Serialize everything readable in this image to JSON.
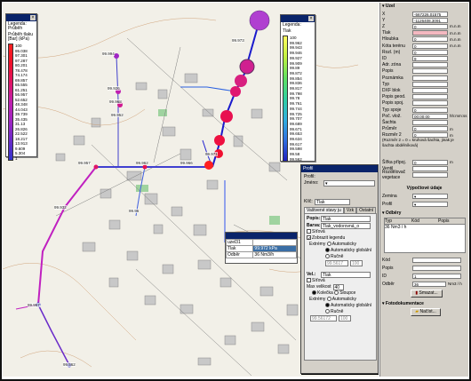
{
  "legend_left": {
    "title": "Legenda: Průběh",
    "subtitle": "Průběh tlaku [Bar] (kPa)",
    "ticks": [
      "100",
      "95.038",
      "97.301",
      "97.287",
      "80.201",
      "78.478",
      "74.174",
      "69.857",
      "65.555",
      "61.251",
      "56.957",
      "52.652",
      "48.348",
      "44.043",
      "39.739",
      "35.435",
      "31.13",
      "26.826",
      "22.522",
      "18.217",
      "13.913",
      "9.609",
      "5.304",
      "1"
    ],
    "colors": [
      "#3333cc",
      "#6a2bc9",
      "#a026c4",
      "#c020b0",
      "#d81a8a",
      "#e01566",
      "#e81048",
      "#f0102a",
      "#ff2020"
    ]
  },
  "legend_right": {
    "title": "Legenda:",
    "subtitle": "Tlak",
    "ticks": [
      "100",
      "99.962",
      "99.943",
      "99.946",
      "99.927",
      "99.909",
      "99.89",
      "99.872",
      "99.854",
      "99.836",
      "99.817",
      "99.798",
      "99.78",
      "99.761",
      "99.744",
      "99.725",
      "99.707",
      "99.689",
      "99.671",
      "99.653",
      "99.634",
      "99.617",
      "99.598",
      "99.58",
      "99.562"
    ]
  },
  "map_labels": [
    "99.994",
    "99.926",
    "99.968",
    "99.952",
    "99.973",
    "99.971",
    "99.957",
    "99.962",
    "99.966",
    "99.932",
    "99.96",
    "99.957",
    "99.562"
  ],
  "info_table": {
    "rows": [
      [
        "uzel31",
        ""
      ],
      [
        "Tlak",
        "99.972 kPa"
      ],
      [
        "Odběr",
        "36 Nm3/h"
      ]
    ]
  },
  "profile_dialog": {
    "title": "Profil",
    "label_profil": "Profil:",
    "label_zobrazeni": "Jméno:",
    "label_klic": "Klíč:",
    "klic_value": "Tlak",
    "tabs": [
      "Vaštvené stavy ju",
      "Vzk",
      "Ostatní"
    ],
    "label_popis": "Popis:",
    "popis_value": "Tlak",
    "label_barva": "Barva:",
    "barva_value": "Tlak_vodorovná_o",
    "chk1": "Síťová",
    "chk2": "Zobrazit legendu",
    "extremy_label": "Extrémy",
    "radio1": "Automaticky",
    "radio2": "Automaticky globální",
    "radio3": "Ručně",
    "min_val": "99.5617",
    "max_val": "100",
    "label_vel": "Vel.:",
    "vel_value": "Tlak",
    "chk3": "Síťová",
    "max_label": "Max velikost",
    "max_size": "40",
    "radio4": "Kolečka",
    "radio5": "Sloupce",
    "extremy2": "Extrémy",
    "radio6": "Automaticky",
    "radio7": "Automaticky globální",
    "radio8": "Ručně",
    "min2": "99.56172",
    "max2": "100"
  },
  "properties_panel": {
    "header": "Uzel",
    "fields": [
      {
        "label": "X",
        "value": "-567226.01575",
        "unit": ""
      },
      {
        "label": "Y",
        "value": "-1126408.3091",
        "unit": ""
      },
      {
        "label": "Z",
        "value": "0",
        "unit": "m.n.m"
      },
      {
        "label": "Tlak",
        "value": "",
        "unit": "m.n.m"
      },
      {
        "label": "Hloubka",
        "value": "0",
        "unit": "m.n.m"
      },
      {
        "label": "Kóta terénu",
        "value": "0",
        "unit": "m.n.m"
      },
      {
        "label": "Rozl. (m)",
        "value": "0",
        "unit": ""
      },
      {
        "label": "ID",
        "value": "9",
        "unit": ""
      },
      {
        "label": "Adr. zóna",
        "value": "",
        "unit": ""
      },
      {
        "label": "Popis",
        "value": "",
        "unit": ""
      },
      {
        "label": "Poznámka",
        "value": "",
        "unit": ""
      },
      {
        "label": "Typ",
        "value": "",
        "unit": ""
      },
      {
        "label": "DXF blok",
        "value": "",
        "unit": ""
      },
      {
        "label": "Popis geod.",
        "value": "",
        "unit": ""
      },
      {
        "label": "Popis spoj.",
        "value": "",
        "unit": ""
      },
      {
        "label": "Typ spoje",
        "value": "0",
        "unit": ""
      },
      {
        "label": "Poč. vlož.",
        "value": "00:00:00",
        "unit": "hh:mm:ss"
      },
      {
        "label": "Šachta",
        "value": "",
        "unit": ""
      },
      {
        "label": "Průměr",
        "value": "0",
        "unit": "m"
      },
      {
        "label": "Rozměr 2",
        "value": "0",
        "unit": "m"
      }
    ],
    "note": "(Rozměr 2 = 0 = kruhová šachta, jinak je šachta obdélníková)",
    "fields2": [
      {
        "label": "Šířka přípoj.",
        "value": "0",
        "unit": "m"
      },
      {
        "label": "Ventil",
        "value": "",
        "unit": ""
      },
      {
        "label": "Rozdělovač vegetace",
        "value": "",
        "unit": ""
      }
    ],
    "vypocet_header": "Výpočtové údaje",
    "zemina_label": "Zemina",
    "profil_label": "Profil",
    "odbery_header": "Odběry",
    "odbery_cols": [
      "Typ",
      "Kód",
      "Popis"
    ],
    "odbery_row": [
      "36 Nm3 / h",
      "",
      ""
    ],
    "kod_label": "Kód",
    "popis_label": "Popis",
    "id_label": "ID",
    "id_value": "1",
    "odber_label": "Odběr",
    "odber_value": "36",
    "odber_unit": "Nm3 / h",
    "smazat_button": "Smazat...",
    "fotodok_header": "Fotodokumentace",
    "nacist_button": "Načíst..."
  }
}
